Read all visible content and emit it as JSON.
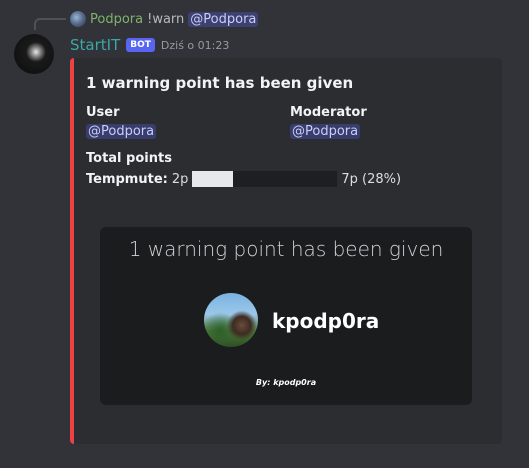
{
  "reply": {
    "author": "Podpora",
    "command": "!warn",
    "mention": "@Podpora"
  },
  "message": {
    "bot_name": "StartIT",
    "bot_tag": "BOT",
    "timestamp": "Dziś o 01:23"
  },
  "embed": {
    "accent_color": "#ed4245",
    "title": "1 warning point has been given",
    "fields": {
      "user": {
        "label": "User",
        "value": "@Podpora"
      },
      "moderator": {
        "label": "Moderator",
        "value": "@Podpora"
      },
      "total_points": {
        "label": "Total points"
      }
    },
    "tempmute": {
      "label": "Tempmute:",
      "start": "2p",
      "end": "7p (28%)",
      "progress_fraction": 0.28
    },
    "image": {
      "title": "1 warning point has been given",
      "username": "kpodp0ra",
      "footer": "By: kpodp0ra"
    }
  }
}
